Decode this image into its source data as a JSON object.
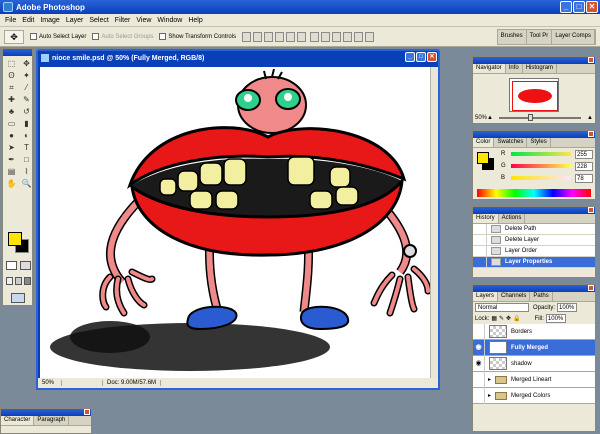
{
  "app": {
    "title": "Adobe Photoshop"
  },
  "menu": [
    "File",
    "Edit",
    "Image",
    "Layer",
    "Select",
    "Filter",
    "View",
    "Window",
    "Help"
  ],
  "options": {
    "auto_select_layer": "Auto Select Layer",
    "auto_select_groups": "Auto Select Groups",
    "show_transform": "Show Transform Controls",
    "dock_tabs": [
      "Brushes",
      "Tool Pr",
      "Layer Comps"
    ]
  },
  "document": {
    "title": "nioce smile.psd @ 50% (Fully Merged, RGB/8)",
    "zoom": "50%",
    "doc_info": "Doc: 9.00M/57.6M"
  },
  "navigator": {
    "tabs": [
      "Navigator",
      "Info",
      "Histogram"
    ],
    "zoom": "50%"
  },
  "color": {
    "tabs": [
      "Color",
      "Swatches",
      "Styles"
    ],
    "r": {
      "label": "R",
      "value": "255"
    },
    "g": {
      "label": "G",
      "value": "228"
    },
    "b": {
      "label": "B",
      "value": "78"
    },
    "fg": "#ffe400"
  },
  "history": {
    "tabs": [
      "History",
      "Actions"
    ],
    "items": [
      "Delete Path",
      "Delete Layer",
      "Layer Order",
      "Layer Properties"
    ]
  },
  "layers": {
    "tabs": [
      "Layers",
      "Channels",
      "Paths"
    ],
    "blend": "Normal",
    "opacity_label": "Opacity:",
    "opacity": "100%",
    "lock_label": "Lock:",
    "fill_label": "Fill:",
    "fill": "100%",
    "items": [
      "Borders",
      "Fully Merged",
      "shadow",
      "Merged Lineart",
      "Merged Colors"
    ]
  },
  "character": {
    "tabs": [
      "Character",
      "Paragraph"
    ]
  }
}
